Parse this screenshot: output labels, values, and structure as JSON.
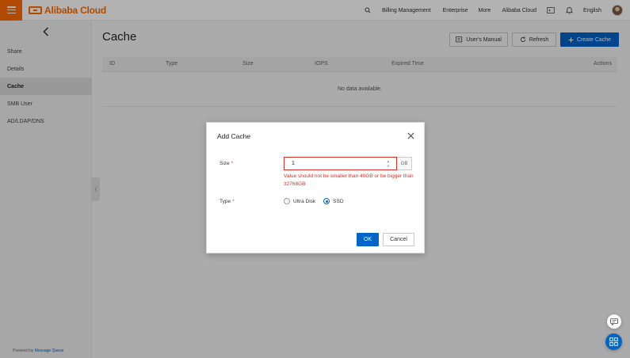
{
  "brand": {
    "name": "Alibaba Cloud",
    "color": "#ff6a00",
    "accent": "#0064c8",
    "error_color": "#d93026"
  },
  "topbar": {
    "nav": [
      {
        "label": "Billing Management"
      },
      {
        "label": "Enterprise"
      },
      {
        "label": "More"
      },
      {
        "label": "Alibaba Cloud"
      }
    ],
    "language": "English",
    "icons": [
      "search-icon",
      "terminal-icon",
      "bell-icon",
      "avatar"
    ]
  },
  "sidebar": {
    "items": [
      {
        "label": "Share"
      },
      {
        "label": "Details"
      },
      {
        "label": "Cache",
        "active": true
      },
      {
        "label": "SMB User"
      },
      {
        "label": "AD/LDAP/DNS"
      }
    ],
    "powered_prefix": "Powered by",
    "powered_link": "Message Queue"
  },
  "main": {
    "title": "Cache",
    "buttons": {
      "manual": "User's Manual",
      "refresh": "Refresh",
      "create": "Create Cache"
    },
    "table": {
      "columns": [
        "ID",
        "Type",
        "Size",
        "IOPS",
        "Expired Time",
        "Actions"
      ],
      "empty_text": "No data available."
    }
  },
  "dialog": {
    "title": "Add Cache",
    "size_label": "Size",
    "size_value": "1",
    "size_unit": "GB",
    "size_error": "Value should not be smaller than 40GB or be bigger than 32768GB",
    "type_label": "Type",
    "required_mark": "*",
    "type_options": [
      {
        "label": "Ultra Disk",
        "checked": false
      },
      {
        "label": "SSD",
        "checked": true
      }
    ],
    "ok": "OK",
    "cancel": "Cancel"
  }
}
